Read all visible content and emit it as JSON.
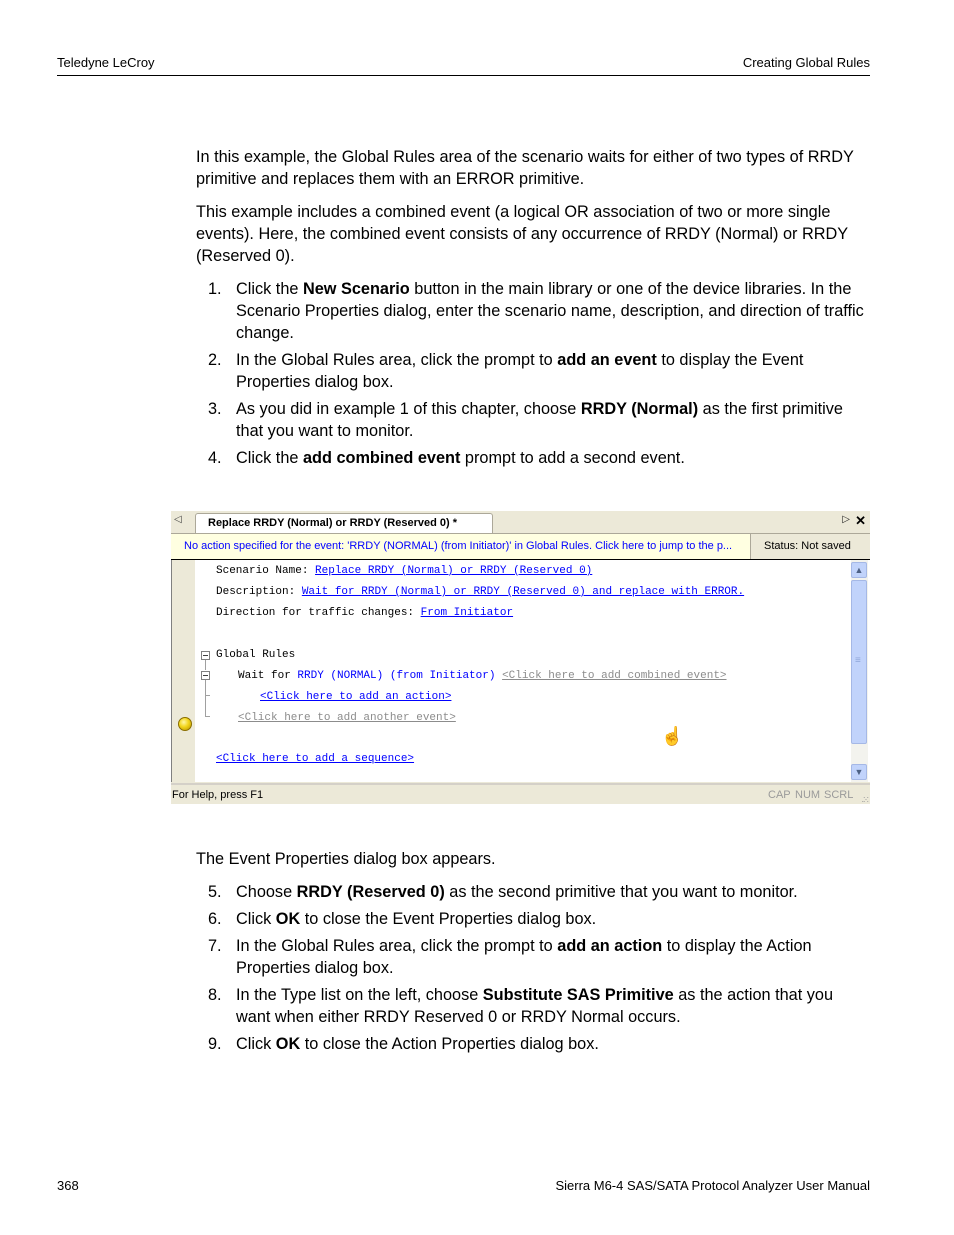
{
  "header": {
    "left": "Teledyne LeCroy",
    "right": "Creating Global Rules"
  },
  "intro": {
    "p1": "In this example, the Global Rules area of the scenario waits for either of two types of RRDY primitive and replaces them with an ERROR primitive.",
    "p2": "This example includes a combined event (a logical OR association of two or more single events). Here, the combined event consists of any occurrence of RRDY (Normal) or RRDY (Reserved 0)."
  },
  "steps_a": [
    {
      "num": "1.",
      "pre": "Click the ",
      "bold": "New Scenario",
      "post": " button in the main library or one of the device libraries. In the Scenario Properties dialog, enter the scenario name, description, and direction of traffic change."
    },
    {
      "num": "2.",
      "pre": "In the Global Rules area, click the prompt to ",
      "bold": "add an event",
      "post": " to display the Event Properties dialog box."
    },
    {
      "num": "3.",
      "pre": "As you did in example 1 of this chapter, choose ",
      "bold": "RRDY (Normal)",
      "post": " as the first primitive that you want to monitor."
    },
    {
      "num": "4.",
      "pre": "Click the ",
      "bold": "add combined event",
      "post": " prompt to add a second event."
    }
  ],
  "app": {
    "tab_title": "Replace RRDY (Normal) or RRDY (Reserved 0) *",
    "info_message": "No action specified for the event: 'RRDY (NORMAL) (from Initiator)' in Global Rules.  Click here to jump to the p...",
    "status": "Status: Not saved",
    "scenario_name_label": "Scenario Name: ",
    "scenario_name_value": "Replace RRDY (Normal) or RRDY (Reserved 0)",
    "description_label": "Description: ",
    "description_value": "Wait for RRDY (Normal) or RRDY (Reserved 0) and replace with ERROR.",
    "direction_label": "Direction for traffic changes: ",
    "direction_value": "From Initiator",
    "global_rules_label": "Global Rules",
    "wait_for_label": "Wait for ",
    "event_value": "RRDY (NORMAL) (from Initiator)",
    "add_combined_event": "<Click here to add combined event>",
    "add_action": "<Click here to add an action>",
    "add_another_event": "<Click here to add another event>",
    "add_sequence": "<Click here to add a sequence>",
    "statusbar_help": "For Help, press F1",
    "indicators": [
      "CAP",
      "NUM",
      "SCRL"
    ]
  },
  "after_figure": "The Event Properties dialog box appears.",
  "steps_b": [
    {
      "num": "5.",
      "pre": "Choose ",
      "bold": "RRDY (Reserved 0)",
      "post": " as the second primitive that you want to monitor."
    },
    {
      "num": "6.",
      "pre": "Click ",
      "bold": "OK",
      "post": " to close the Event Properties dialog box."
    },
    {
      "num": "7.",
      "pre": "In the Global Rules area, click the prompt to ",
      "bold": "add an action",
      "post": " to display the Action Properties dialog box."
    },
    {
      "num": "8.",
      "pre": "In the Type list on the left, choose ",
      "bold": "Substitute SAS Primitive",
      "post": " as the action that you want when either RRDY Reserved 0 or RRDY Normal occurs."
    },
    {
      "num": "9.",
      "pre": "Click ",
      "bold": "OK",
      "post": " to close the Action Properties dialog box."
    }
  ],
  "footer": {
    "page_number": "368",
    "manual_title": "Sierra M6-4 SAS/SATA Protocol Analyzer User Manual"
  }
}
